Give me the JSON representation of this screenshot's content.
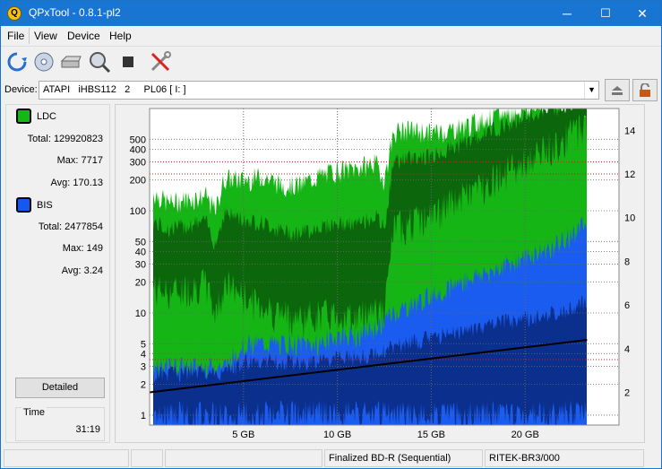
{
  "window": {
    "title": "QPxTool - 0.8.1-pl2",
    "app_icon": "Q"
  },
  "titlebar_buttons": {
    "minimize": "─",
    "maximize": "☐",
    "close": "✕"
  },
  "menu": [
    "File",
    "View",
    "Device",
    "Help"
  ],
  "toolbar_icons": [
    "refresh-icon",
    "disc-info-icon",
    "drive-icon",
    "scan-icon",
    "stop-icon",
    "settings-tools-icon"
  ],
  "device": {
    "label": "Device:",
    "value": "ATAPI   iHBS112   2     PL06 [ I: ]"
  },
  "left_panel": {
    "ldc": {
      "label": "LDC",
      "color": "#14b814",
      "total_label": "Total:",
      "total": "129920823",
      "max_label": "Max:",
      "max": "7717",
      "avg_label": "Avg:",
      "avg": "170.13"
    },
    "bis": {
      "label": "BIS",
      "color": "#1558f0",
      "total_label": "Total:",
      "total": "2477854",
      "max_label": "Max:",
      "max": "149",
      "avg_label": "Avg:",
      "avg": "3.24"
    },
    "detailed_button": "Detailed",
    "time_label": "Time",
    "time_value": "31:19"
  },
  "status": {
    "disc_status": "Finalized BD-R (Sequential)",
    "media_id": "RITEK-BR3/000"
  },
  "chart_data": {
    "type": "area",
    "x_ticks": [
      {
        "gb": 5,
        "label": "5 GB"
      },
      {
        "gb": 10,
        "label": "10 GB"
      },
      {
        "gb": 15,
        "label": "15 GB"
      },
      {
        "gb": 20,
        "label": "20 GB"
      }
    ],
    "xlim": [
      0,
      25
    ],
    "data_end_gb": 23.3,
    "y_left_scale": "log",
    "y_left_lim": [
      0.8,
      1000
    ],
    "y_left_ticks": [
      "1",
      "2",
      "3",
      "4",
      "5",
      "10",
      "20",
      "30",
      "40",
      "50",
      "100",
      "200",
      "300",
      "400",
      "500"
    ],
    "y_right_lim": [
      0.5,
      15
    ],
    "y_right_ticks": [
      "2",
      "4",
      "6",
      "8",
      "10",
      "12",
      "14"
    ],
    "grid": true,
    "colors": {
      "ldc": "#15b515",
      "ldc_dark": "#0c660c",
      "bis": "#1a5cf0",
      "bis_dark": "#0b2f8c",
      "speed": "#000000",
      "plot_bg": "#ffffff"
    },
    "series": [
      {
        "name": "LDC",
        "x": [
          0.2,
          1,
          2,
          3,
          3.5,
          4,
          5,
          6,
          7,
          8,
          9,
          10,
          11,
          12,
          12.5,
          13,
          14,
          15,
          16,
          17,
          18,
          19,
          20,
          21,
          22,
          23
        ],
        "high": [
          150,
          120,
          130,
          140,
          100,
          210,
          200,
          220,
          180,
          180,
          220,
          250,
          260,
          300,
          200,
          600,
          620,
          580,
          620,
          700,
          800,
          900,
          1000,
          1000,
          1000,
          1000
        ],
        "low": [
          18,
          16,
          18,
          20,
          10,
          20,
          15,
          12,
          10,
          9,
          10,
          10,
          9,
          12,
          10,
          70,
          80,
          90,
          120,
          150,
          200,
          250,
          300,
          400,
          500,
          700
        ]
      },
      {
        "name": "BIS",
        "x": [
          0.2,
          1,
          2,
          3,
          4,
          5,
          6,
          7,
          8,
          9,
          10,
          11,
          12,
          13,
          14,
          15,
          16,
          17,
          18,
          19,
          20,
          21,
          22,
          23
        ],
        "high": [
          3,
          3,
          3,
          3,
          3,
          5,
          5,
          5,
          5,
          5,
          6,
          6,
          7,
          10,
          12,
          15,
          18,
          22,
          25,
          30,
          35,
          40,
          50,
          70
        ],
        "low": [
          1,
          1,
          1,
          1,
          1,
          1,
          1,
          1,
          1,
          1,
          1,
          1,
          1,
          1,
          1,
          1,
          1,
          1,
          1,
          1,
          1,
          1,
          1,
          1
        ]
      },
      {
        "name": "Speed",
        "x": [
          0,
          23.3
        ],
        "y": [
          2.0,
          4.4
        ]
      }
    ],
    "reference_lines_left": [
      300,
      3.5
    ],
    "reference_lines_right": [
      12
    ]
  }
}
